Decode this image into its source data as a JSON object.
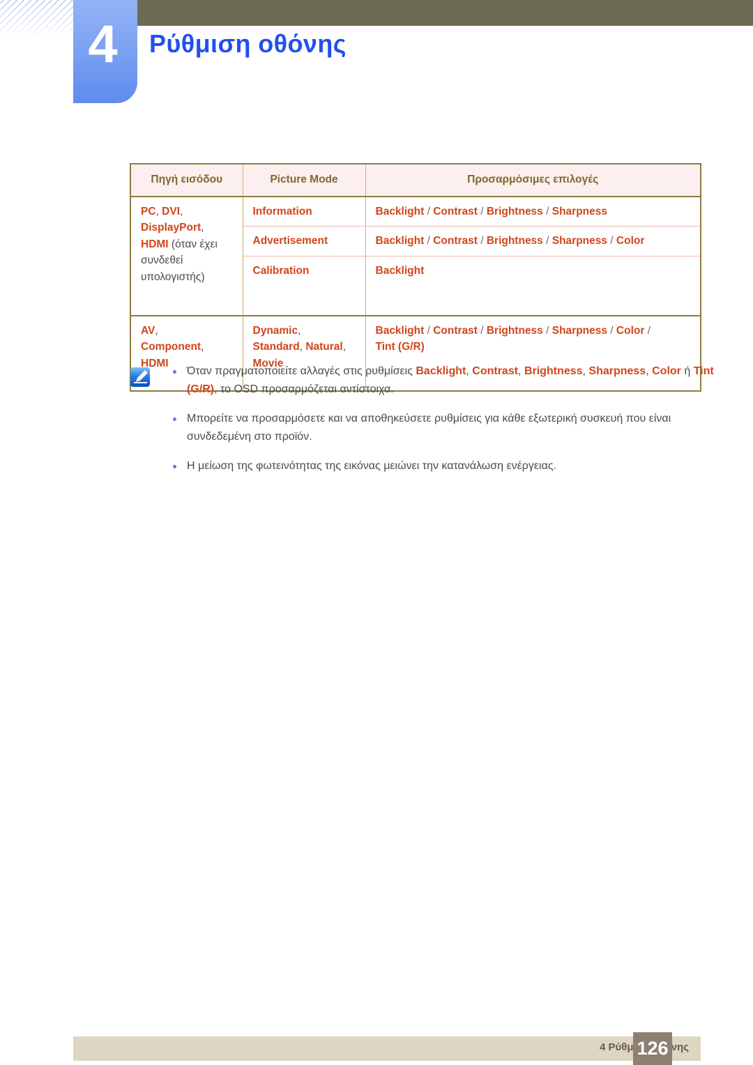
{
  "chapter": {
    "number": "4",
    "title": "Ρύθμιση οθόνης"
  },
  "table": {
    "headers": [
      "Πηγή εισόδου",
      "Picture Mode",
      "Προσαρμόσιμες επιλογές"
    ],
    "groups": [
      {
        "source": {
          "terms": [
            "PC",
            "DVI",
            "DisplayPort",
            "HDMI"
          ],
          "note": "(όταν έχει συνδεθεί υπολογιστής)",
          "line1_a": "PC",
          "line1_sep": ", ",
          "line1_b": "DVI",
          "line1_tail": ",",
          "line2_a": "DisplayPort",
          "line2_tail": ",",
          "line3_a": "HDMI",
          "line3_tail": " (όταν έχει",
          "line4": "συνδεθεί",
          "line5": "υπολογιστής)"
        },
        "rows": [
          {
            "mode": "Information",
            "options": [
              "Backlight",
              "Contrast",
              "Brightness",
              "Sharpness"
            ]
          },
          {
            "mode": "Advertisement",
            "options": [
              "Backlight",
              "Contrast",
              "Brightness",
              "Sharpness",
              "Color"
            ]
          },
          {
            "mode": "Calibration",
            "options": [
              "Backlight"
            ]
          }
        ]
      },
      {
        "source": {
          "line1_a": "AV",
          "line1_tail": ",",
          "line2_a": "Component",
          "line2_tail": ",",
          "line3_a": "HDMI"
        },
        "rows": [
          {
            "mode_parts": [
              "Dynamic",
              "Standard",
              "Natural",
              "Movie"
            ],
            "options": [
              "Backlight",
              "Contrast",
              "Brightness",
              "Sharpness",
              "Color",
              "Tint (G/R)"
            ]
          }
        ]
      }
    ]
  },
  "notes": {
    "icon_name": "note-pen-icon",
    "items": [
      {
        "segments": [
          {
            "text": "Όταν πραγματοποιείτε αλλαγές στις ρυθμίσεις ",
            "style": "plain"
          },
          {
            "text": "Backlight",
            "style": "term"
          },
          {
            "text": ", ",
            "style": "plain"
          },
          {
            "text": "Contrast",
            "style": "term"
          },
          {
            "text": ", ",
            "style": "plain"
          },
          {
            "text": "Brightness",
            "style": "term"
          },
          {
            "text": ", ",
            "style": "plain"
          },
          {
            "text": "Sharpness",
            "style": "term"
          },
          {
            "text": ", ",
            "style": "plain"
          },
          {
            "text": "Color",
            "style": "term"
          },
          {
            "text": " ή ",
            "style": "plain"
          },
          {
            "text": "Tint (G/R)",
            "style": "term"
          },
          {
            "text": ", το OSD προσαρμόζεται αντίστοιχα.",
            "style": "plain"
          }
        ]
      },
      {
        "segments": [
          {
            "text": "Μπορείτε να προσαρμόσετε και να αποθηκεύσετε ρυθμίσεις για κάθε εξωτερική συσκευή που είναι συνδεδεμένη στο προϊόν.",
            "style": "plain"
          }
        ]
      },
      {
        "segments": [
          {
            "text": "Η μείωση της φωτεινότητας της εικόνας μειώνει την κατανάλωση ενέργειας.",
            "style": "plain"
          }
        ]
      }
    ]
  },
  "footer": {
    "text": "4 Ρύθμιση οθόνης",
    "page_number": "126"
  },
  "colors": {
    "title_blue": "#2250ee",
    "term_orange": "#d1451a",
    "header_olive": "#7d6a2d",
    "top_bar": "#6b6a53",
    "footer_bar": "#dcd6c3",
    "footer_page_box": "#8d7f72",
    "table_header_bg": "#fcefef"
  }
}
